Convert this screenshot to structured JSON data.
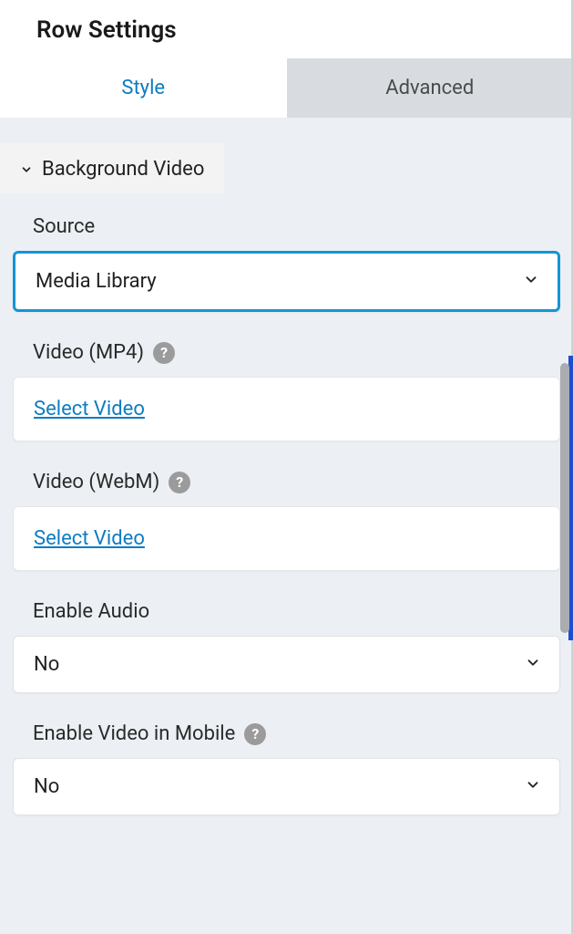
{
  "header": {
    "title": "Row Settings"
  },
  "tabs": {
    "style": "Style",
    "advanced": "Advanced"
  },
  "section": {
    "title": "Background Video"
  },
  "fields": {
    "source": {
      "label": "Source",
      "value": "Media Library"
    },
    "video_mp4": {
      "label": "Video (MP4)",
      "link": "Select Video"
    },
    "video_webm": {
      "label": "Video (WebM)",
      "link": "Select Video"
    },
    "enable_audio": {
      "label": "Enable Audio",
      "value": "No"
    },
    "enable_video_mobile": {
      "label": "Enable Video in Mobile",
      "value": "No"
    }
  },
  "icons": {
    "help": "?"
  }
}
